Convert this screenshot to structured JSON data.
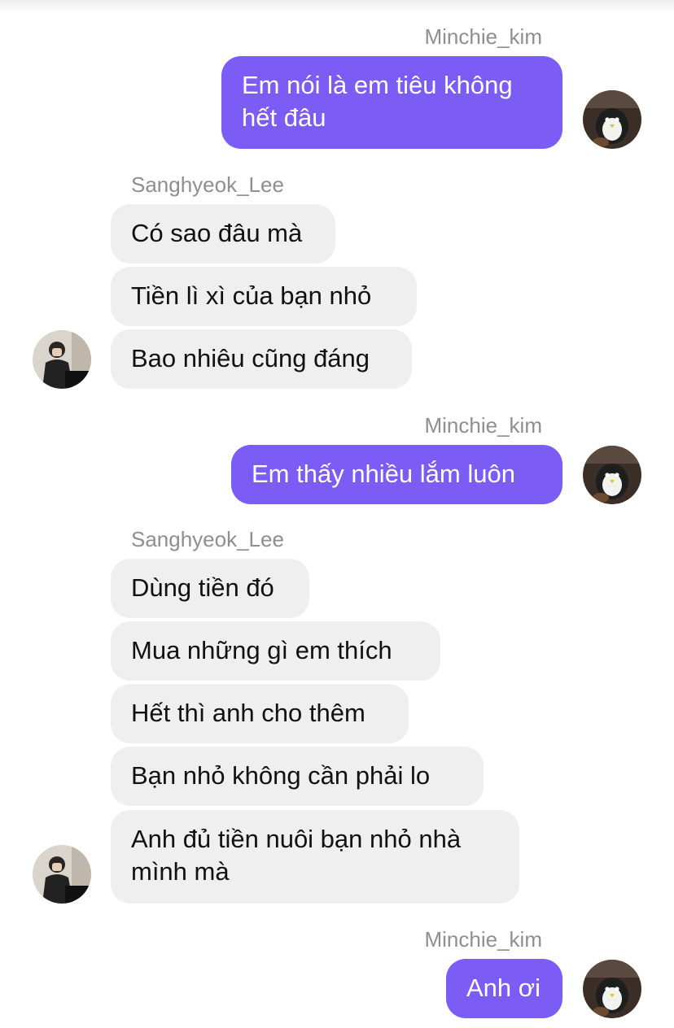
{
  "conversation": [
    {
      "sender": "Minchie_kim",
      "side": "right",
      "messages": [
        "Em nói là em tiêu không\nhết đâu"
      ]
    },
    {
      "sender": "Sanghyeok_Lee",
      "side": "left",
      "messages": [
        "Có sao đâu mà",
        "Tiền lì xì của bạn nhỏ",
        "Bao nhiêu cũng đáng"
      ]
    },
    {
      "sender": "Minchie_kim",
      "side": "right",
      "messages": [
        "Em thấy nhiều lắm luôn"
      ]
    },
    {
      "sender": "Sanghyeok_Lee",
      "side": "left",
      "messages": [
        "Dùng tiền đó",
        "Mua những gì em thích",
        "Hết thì anh cho thêm",
        "Bạn nhỏ không cần phải lo",
        "Anh đủ tiền nuôi bạn nhỏ nhà\nmình mà"
      ]
    },
    {
      "sender": "Minchie_kim",
      "side": "right",
      "messages": [
        "Anh ơi"
      ]
    }
  ],
  "icons": {
    "minchie_avatar": "penguin-plush-avatar-icon",
    "sanghyeok_avatar": "person-at-piano-avatar-icon"
  },
  "colors": {
    "outgoing_bubble": "#7b5cf5",
    "incoming_bubble": "#efefef",
    "sender_name": "#8e8e93"
  }
}
